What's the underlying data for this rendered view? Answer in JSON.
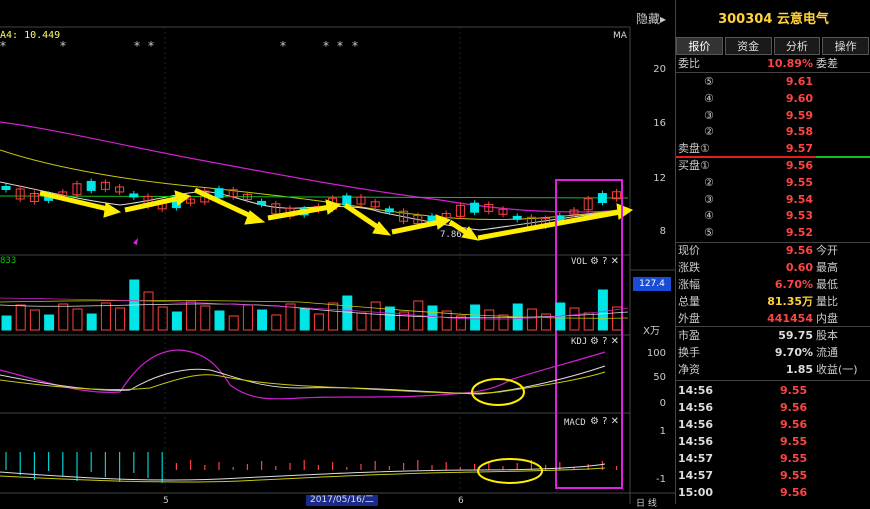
{
  "toolbar": {
    "hide_label": "隐藏▸"
  },
  "ma_label": "A4: 10.449",
  "ma_tag": "MA",
  "vol": {
    "name": "VOL",
    "value_label": "833",
    "badge": "127.4",
    "unit": "X万"
  },
  "kdj": {
    "name": "KDJ"
  },
  "macd": {
    "name": "MACD"
  },
  "indicator_icons": "⚙ ? ✕",
  "price_axis": [
    "20",
    "16",
    "12",
    "8"
  ],
  "vol_axis_unit": "X万",
  "kdj_axis": [
    "100",
    "50",
    "0"
  ],
  "macd_axis": [
    "1",
    "-1"
  ],
  "low_marker": "7.86",
  "x_axis": {
    "label1": "5",
    "date_badge": "2017/05/16/二",
    "label2": "6",
    "right_label": "日 线"
  },
  "panel": {
    "title": "300304 云意电气",
    "tabs": [
      "报价",
      "资金",
      "分析",
      "操作"
    ],
    "weibi": {
      "label": "委比",
      "value": "10.89%",
      "right": "委差"
    },
    "sell": [
      {
        "label": "⑤",
        "price": "9.61"
      },
      {
        "label": "④",
        "price": "9.60"
      },
      {
        "label": "③",
        "price": "9.59"
      },
      {
        "label": "②",
        "price": "9.58"
      },
      {
        "label": "卖盘①",
        "price": "9.57"
      }
    ],
    "buy": [
      {
        "label": "买盘①",
        "price": "9.56"
      },
      {
        "label": "②",
        "price": "9.55"
      },
      {
        "label": "③",
        "price": "9.54"
      },
      {
        "label": "④",
        "price": "9.53"
      },
      {
        "label": "⑤",
        "price": "9.52"
      }
    ],
    "stats": [
      {
        "l": "现价",
        "v": "9.56",
        "r": "今开",
        "color": "red"
      },
      {
        "l": "涨跌",
        "v": "0.60",
        "r": "最高",
        "color": "red"
      },
      {
        "l": "涨幅",
        "v": "6.70%",
        "r": "最低",
        "color": "red"
      },
      {
        "l": "总量",
        "v": "81.35万",
        "r": "量比",
        "color": "yellow"
      },
      {
        "l": "外盘",
        "v": "441454",
        "r": "内盘",
        "color": "red"
      }
    ],
    "stats2": [
      {
        "l": "市盈",
        "v": "59.75",
        "r": "股本",
        "color": "white"
      },
      {
        "l": "换手",
        "v": "9.70%",
        "r": "流通",
        "color": "white"
      },
      {
        "l": "净资",
        "v": "1.85",
        "r": "收益(一)",
        "color": "white"
      }
    ],
    "ticks": [
      {
        "t": "14:56",
        "p": "9.55"
      },
      {
        "t": "14:56",
        "p": "9.56"
      },
      {
        "t": "14:56",
        "p": "9.56"
      },
      {
        "t": "14:56",
        "p": "9.55"
      },
      {
        "t": "14:57",
        "p": "9.55"
      },
      {
        "t": "14:57",
        "p": "9.55"
      },
      {
        "t": "15:00",
        "p": "9.56"
      }
    ]
  }
}
